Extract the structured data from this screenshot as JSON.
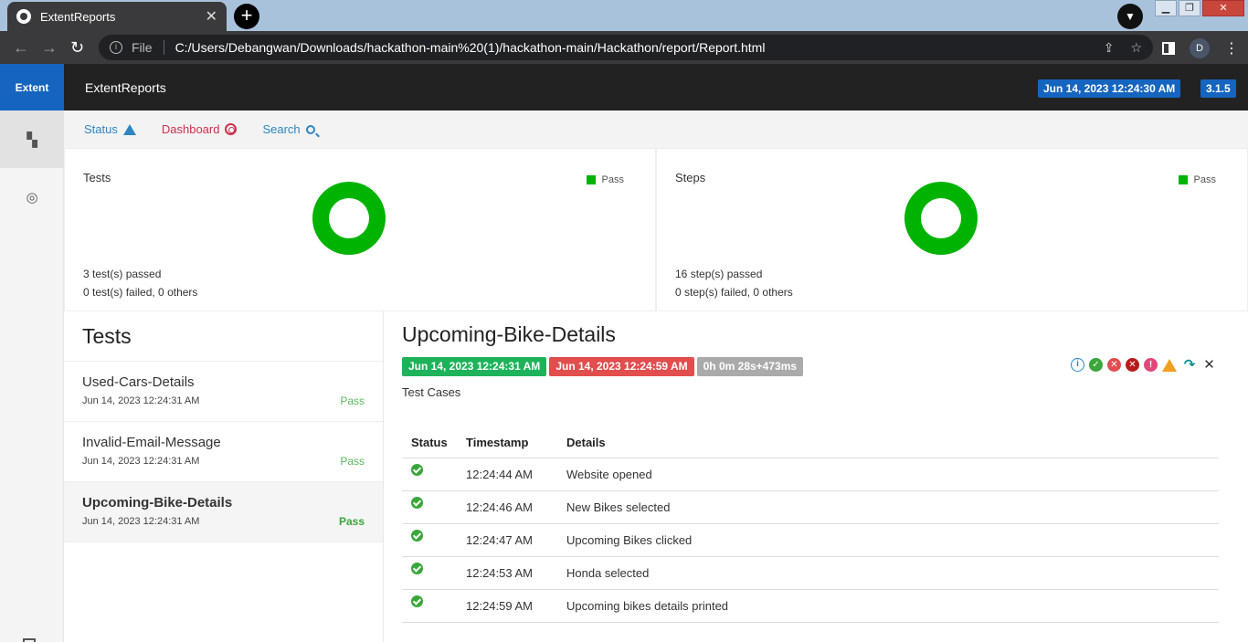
{
  "browser": {
    "tab_title": "ExtentReports",
    "tab_close": "✕",
    "new_tab": "+",
    "protocol": "File",
    "url": "C:/Users/Debangwan/Downloads/hackathon-main%20(1)/hackathon-main/Hackathon/report/Report.html",
    "profile_initial": "D"
  },
  "header": {
    "brand": "Extent",
    "report_name": "ExtentReports",
    "report_date": "Jun 14, 2023 12:24:30 AM",
    "version": "3.1.5"
  },
  "subnav": {
    "status": "Status",
    "dashboard": "Dashboard",
    "search": "Search"
  },
  "summary": {
    "tests": {
      "title": "Tests",
      "legend": "Pass",
      "passed_count": "3",
      "passed_text": " test(s) passed",
      "failed_count": "0",
      "failed_text": " test(s) failed, ",
      "others_count": "0",
      "others_text": " others"
    },
    "steps": {
      "title": "Steps",
      "legend": "Pass",
      "passed_count": "16",
      "passed_text": " step(s) passed",
      "failed_count": "0",
      "failed_text": " step(s) failed, ",
      "others_count": "0",
      "others_text": " others"
    }
  },
  "tests_list": {
    "heading": "Tests",
    "items": [
      {
        "name": "Used-Cars-Details",
        "time": "Jun 14, 2023 12:24:31 AM",
        "status": "Pass"
      },
      {
        "name": "Invalid-Email-Message",
        "time": "Jun 14, 2023 12:24:31 AM",
        "status": "Pass"
      },
      {
        "name": "Upcoming-Bike-Details",
        "time": "Jun 14, 2023 12:24:31 AM",
        "status": "Pass"
      }
    ]
  },
  "detail": {
    "title": "Upcoming-Bike-Details",
    "start": "Jun 14, 2023 12:24:31 AM",
    "end": "Jun 14, 2023 12:24:59 AM",
    "duration": "0h 0m 28s+473ms",
    "category": "Test Cases",
    "columns": [
      "Status",
      "Timestamp",
      "Details"
    ],
    "rows": [
      {
        "time": "12:24:44 AM",
        "details": "Website opened"
      },
      {
        "time": "12:24:46 AM",
        "details": "New Bikes selected"
      },
      {
        "time": "12:24:47 AM",
        "details": "Upcoming Bikes clicked"
      },
      {
        "time": "12:24:53 AM",
        "details": "Honda selected"
      },
      {
        "time": "12:24:59 AM",
        "details": "Upcoming bikes details printed"
      }
    ]
  },
  "colors": {
    "pass": "#00b300",
    "brand": "#1565c0",
    "fail": "#e24d4d"
  }
}
